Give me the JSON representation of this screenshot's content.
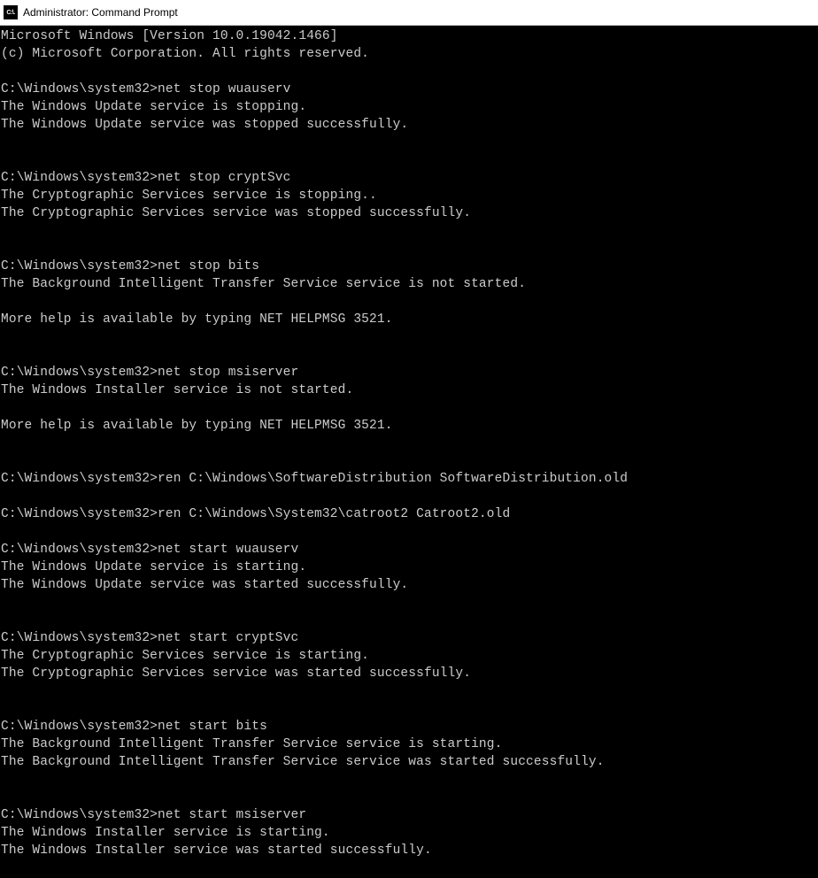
{
  "window": {
    "title": "Administrator: Command Prompt",
    "icon_text": "C:\\."
  },
  "terminal": {
    "lines": [
      "Microsoft Windows [Version 10.0.19042.1466]",
      "(c) Microsoft Corporation. All rights reserved.",
      "",
      "C:\\Windows\\system32>net stop wuauserv",
      "The Windows Update service is stopping.",
      "The Windows Update service was stopped successfully.",
      "",
      "",
      "C:\\Windows\\system32>net stop cryptSvc",
      "The Cryptographic Services service is stopping..",
      "The Cryptographic Services service was stopped successfully.",
      "",
      "",
      "C:\\Windows\\system32>net stop bits",
      "The Background Intelligent Transfer Service service is not started.",
      "",
      "More help is available by typing NET HELPMSG 3521.",
      "",
      "",
      "C:\\Windows\\system32>net stop msiserver",
      "The Windows Installer service is not started.",
      "",
      "More help is available by typing NET HELPMSG 3521.",
      "",
      "",
      "C:\\Windows\\system32>ren C:\\Windows\\SoftwareDistribution SoftwareDistribution.old",
      "",
      "C:\\Windows\\system32>ren C:\\Windows\\System32\\catroot2 Catroot2.old",
      "",
      "C:\\Windows\\system32>net start wuauserv",
      "The Windows Update service is starting.",
      "The Windows Update service was started successfully.",
      "",
      "",
      "C:\\Windows\\system32>net start cryptSvc",
      "The Cryptographic Services service is starting.",
      "The Cryptographic Services service was started successfully.",
      "",
      "",
      "C:\\Windows\\system32>net start bits",
      "The Background Intelligent Transfer Service service is starting.",
      "The Background Intelligent Transfer Service service was started successfully.",
      "",
      "",
      "C:\\Windows\\system32>net start msiserver",
      "The Windows Installer service is starting.",
      "The Windows Installer service was started successfully."
    ]
  }
}
